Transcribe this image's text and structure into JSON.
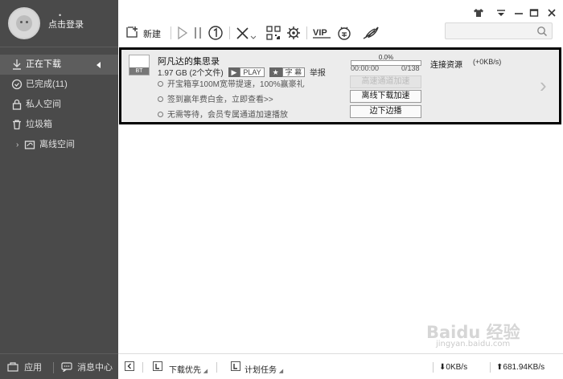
{
  "user": {
    "login_label": "点击登录",
    "login_mark": "•"
  },
  "sidebar": {
    "items": [
      {
        "label": "正在下载",
        "icon": "download-arrow-icon",
        "active": true
      },
      {
        "label": "已完成(11)",
        "icon": "check-circle-icon"
      },
      {
        "label": "私人空间",
        "icon": "lock-icon"
      },
      {
        "label": "垃圾箱",
        "icon": "trash-icon"
      },
      {
        "label": "离线空间",
        "icon": "cloud-folder-icon"
      }
    ],
    "bottom": {
      "apps_label": "应用",
      "messages_label": "消息中心"
    }
  },
  "toolbar": {
    "new_label": "新建",
    "search_placeholder": ""
  },
  "task": {
    "title": "阿凡达的集思录",
    "size": "1.97 GB",
    "files": "(2个文件)",
    "tag_play": "PLAY",
    "tag_subtitle": "字 幕",
    "report": "举报",
    "promos": [
      "开宝箱享100M宽带提速，100%赢豪礼",
      "签到赢年费白金，立即查看>>",
      "无需等待，会员专属通道加速播放"
    ],
    "progress_text": "0.0%",
    "progress_fraction": 0.0,
    "time_left": "00:00:00",
    "count": "0/138",
    "status": "连接资源",
    "speed": "(+0KB/s)",
    "btn_high_speed": "高速通道加速",
    "btn_offline": "离线下载加速",
    "btn_play": "边下边播"
  },
  "statusbar": {
    "download_priority": "下载优先",
    "scheduled": "计划任务",
    "down_speed": "0KB/s",
    "up_speed": "681.94KB/s"
  },
  "watermark": {
    "main": "Baidu 经验",
    "sub": "jingyan.baidu.com"
  },
  "colors": {
    "sidebar_bg": "#4a4a4a",
    "active_item_bg": "#5d5d5d",
    "task_border": "#000000"
  }
}
